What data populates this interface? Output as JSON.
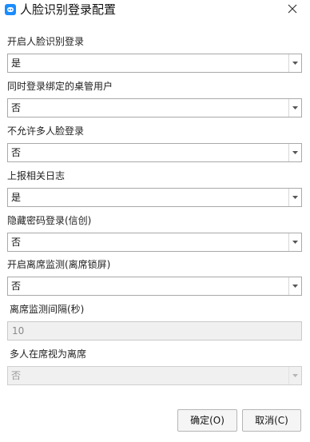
{
  "window": {
    "title": "人脸识别登录配置"
  },
  "fields": [
    {
      "label": "开启人脸识别登录",
      "value": "是"
    },
    {
      "label": "同时登录绑定的桌管用户",
      "value": "否"
    },
    {
      "label": "不允许多人脸登录",
      "value": "否"
    },
    {
      "label": "上报相关日志",
      "value": "是"
    },
    {
      "label": "隐藏密码登录(信创)",
      "value": "否"
    },
    {
      "label": "开启离席监测(离席锁屏)",
      "value": "否"
    }
  ],
  "interval": {
    "label": "离席监测间隔(秒)",
    "value": "10"
  },
  "multi_person": {
    "label": "多人在席视为离席",
    "value": "否"
  },
  "buttons": {
    "ok": "确定(O)",
    "cancel": "取消(C)"
  },
  "colors": {
    "accent": "#1a8cff"
  }
}
